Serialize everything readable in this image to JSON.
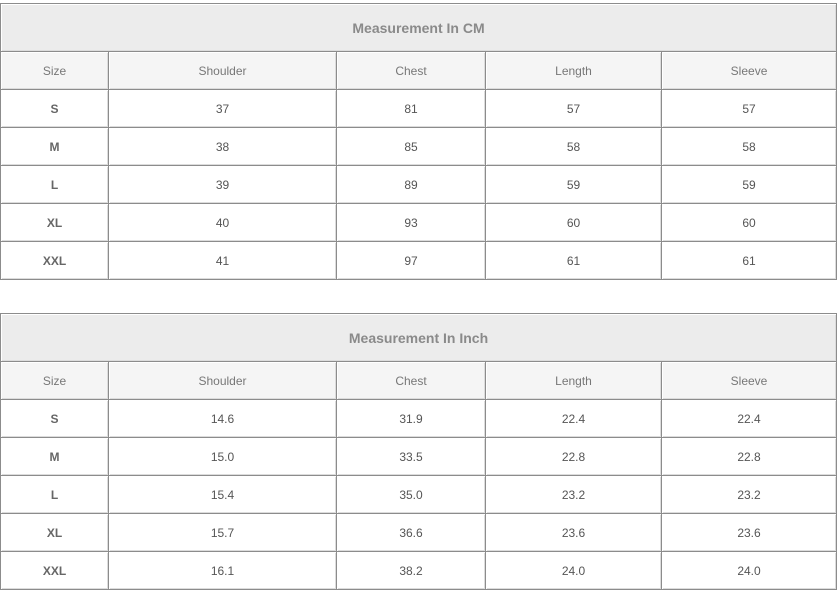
{
  "tables": [
    {
      "title": "Measurement In CM",
      "headers": [
        "Size",
        "Shoulder",
        "Chest",
        "Length",
        "Sleeve"
      ],
      "rows": [
        [
          "S",
          "37",
          "81",
          "57",
          "57"
        ],
        [
          "M",
          "38",
          "85",
          "58",
          "58"
        ],
        [
          "L",
          "39",
          "89",
          "59",
          "59"
        ],
        [
          "XL",
          "40",
          "93",
          "60",
          "60"
        ],
        [
          "XXL",
          "41",
          "97",
          "61",
          "61"
        ]
      ]
    },
    {
      "title": "Measurement In Inch",
      "headers": [
        "Size",
        "Shoulder",
        "Chest",
        "Length",
        "Sleeve"
      ],
      "rows": [
        [
          "S",
          "14.6",
          "31.9",
          "22.4",
          "22.4"
        ],
        [
          "M",
          "15.0",
          "33.5",
          "22.8",
          "22.8"
        ],
        [
          "L",
          "15.4",
          "35.0",
          "23.2",
          "23.2"
        ],
        [
          "XL",
          "15.7",
          "36.6",
          "23.6",
          "23.6"
        ],
        [
          "XXL",
          "16.1",
          "38.2",
          "24.0",
          "24.0"
        ]
      ]
    }
  ]
}
